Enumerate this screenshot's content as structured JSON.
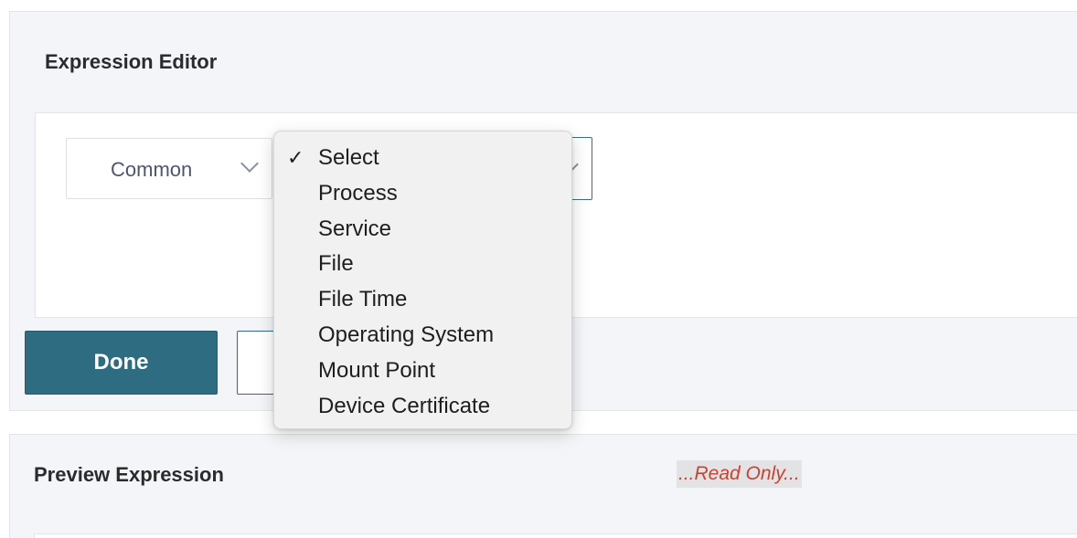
{
  "editor": {
    "title": "Expression Editor",
    "common_select": {
      "value": "Common"
    },
    "category_select": {
      "value": ""
    },
    "done_label": "Done",
    "cancel_label": ""
  },
  "dropdown": {
    "selected": "Select",
    "check_glyph": "✓",
    "options": [
      "Select",
      "Process",
      "Service",
      "File",
      "File Time",
      "Operating System",
      "Mount Point",
      "Device Certificate"
    ]
  },
  "preview": {
    "title": "Preview Expression",
    "readonly_label": "...Read Only..."
  },
  "colors": {
    "primary_button": "#2e6d81",
    "readonly_text": "#c9432e",
    "panel_bg": "#f4f5f9"
  },
  "icons": {
    "select_chevron": "chevron-down-icon",
    "selected_check": "checkmark-icon"
  }
}
